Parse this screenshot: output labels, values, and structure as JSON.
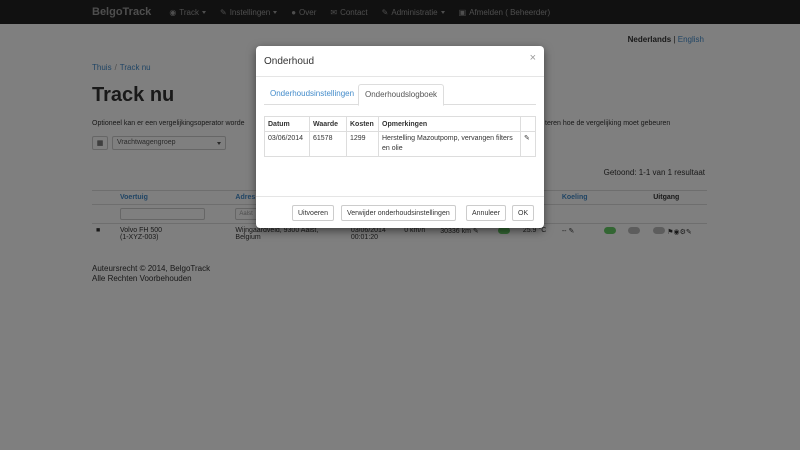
{
  "navbar": {
    "brand": "BelgoTrack",
    "items": [
      {
        "label": "Track",
        "icon": "globe-icon",
        "has_caret": true
      },
      {
        "label": "Instellingen",
        "icon": "wrench-icon",
        "has_caret": true
      },
      {
        "label": "Over",
        "icon": "info-icon",
        "has_caret": false
      },
      {
        "label": "Contact",
        "icon": "envelope-icon",
        "has_caret": false
      },
      {
        "label": "Administratie",
        "icon": "wrench-icon",
        "has_caret": true
      },
      {
        "label": "Afmelden ( Beheerder)",
        "icon": "lock-icon",
        "has_caret": false
      }
    ]
  },
  "language": {
    "active": "Nederlands",
    "separator": "|",
    "other": "English"
  },
  "breadcrumb": {
    "home": "Thuis",
    "current": "Track nu"
  },
  "page_title": "Track nu",
  "description": {
    "left": "Optioneel kan er een vergelijkingsoperator worde",
    "right": "teren hoe de vergelijking moet gebeuren"
  },
  "filter": {
    "select_value": "Vrachtwagengroep"
  },
  "results_text": "Getoond: 1-1 van 1 resultaat",
  "table": {
    "headers": {
      "vehicle": "Voertuig",
      "address": "Adres",
      "cooling": "Koeling",
      "output": "Uitgang"
    },
    "filter_placeholder": "Aalst",
    "row": {
      "vehicle_name": "Volvo FH 500",
      "vehicle_plate": "(1-XYZ-003)",
      "address_line1": "Wijngaardveld, 9300 Aalst,",
      "address_line2": "Belgium",
      "date": "03/06/2014",
      "time": "00:01:20",
      "speed": "0 km/h",
      "odometer": "30336 km",
      "temperature": "25.9 °C",
      "dash": "--"
    }
  },
  "footer": {
    "line1": "Auteursrecht © 2014, BelgoTrack",
    "line2": "Alle Rechten Voorbehouden"
  },
  "modal": {
    "title": "Onderhoud",
    "close": "×",
    "tabs": [
      "Onderhoudsinstellingen",
      "Onderhoudslogboek"
    ],
    "log_headers": [
      "Datum",
      "Waarde",
      "Kosten",
      "Opmerkingen"
    ],
    "log_rows": [
      {
        "date": "03/06/2014",
        "value": "61578",
        "cost": "1299",
        "remark_line1": "Herstelling Mazoutpomp, vervangen filters",
        "remark_line2": "en olie"
      }
    ],
    "buttons": {
      "execute": "Uitvoeren",
      "remove": "Verwijder onderhoudsinstellingen",
      "cancel": "Annuleer",
      "ok": "OK"
    }
  }
}
